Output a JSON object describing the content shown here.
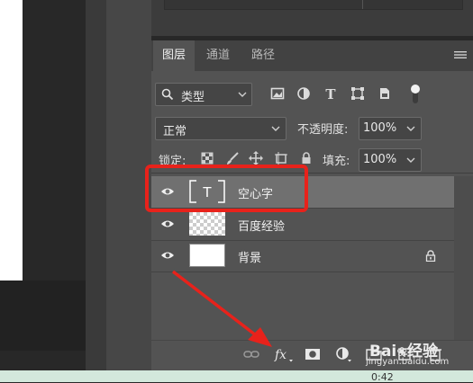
{
  "tabs": [
    "图层",
    "通道",
    "路径"
  ],
  "filter": {
    "label": "类型",
    "icon": "search-icon"
  },
  "blend_mode": "正常",
  "opacity": {
    "label": "不透明度:",
    "value": "100%"
  },
  "lock": {
    "label": "锁定:"
  },
  "fill": {
    "label": "填充:",
    "value": "100%"
  },
  "layers": [
    {
      "name": "空心字",
      "type": "text",
      "selected": true
    },
    {
      "name": "百度经验",
      "type": "transparent",
      "selected": false
    },
    {
      "name": "背景",
      "type": "background",
      "locked": true,
      "selected": false
    }
  ],
  "status": {
    "time": "0:42"
  },
  "watermark": {
    "url": "jingyan.baidu.com"
  },
  "annotation_color": "#e8221b",
  "selection_color": "#707070"
}
